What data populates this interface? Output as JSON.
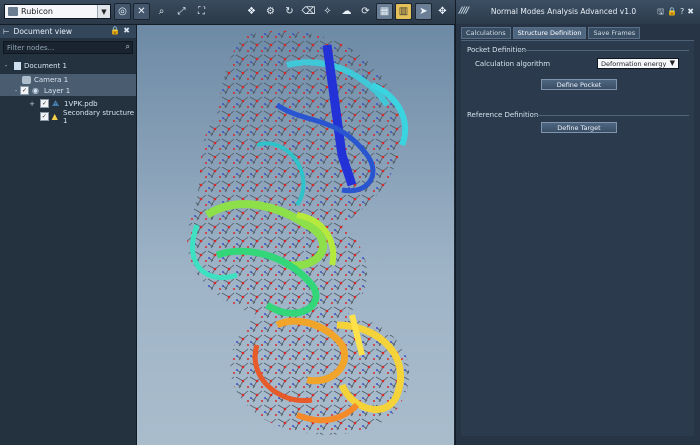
{
  "toolbar": {
    "preset": "Rubicon",
    "buttons": [
      "target-icon",
      "close-icon",
      "zoom-icon",
      "fit-icon",
      "fit-selection-icon",
      "atom-style-icon",
      "wire-icon",
      "rotate-icon",
      "eraser-icon",
      "ribbon-icon",
      "surface-icon",
      "refresh-icon",
      "grid-icon",
      "color-icon",
      "display-icon",
      "pointer-icon",
      "move-icon"
    ]
  },
  "document_view": {
    "title": "Document view",
    "filter_placeholder": "Filter nodes...",
    "tree": [
      {
        "label": "Document 1",
        "level": 0,
        "expander": "-",
        "checked": null,
        "icon": "document-icon",
        "selected": false
      },
      {
        "label": "Camera 1",
        "level": 1,
        "expander": "",
        "checked": null,
        "icon": "camera-icon",
        "selected": true
      },
      {
        "label": "Layer 1",
        "level": 1,
        "expander": "-",
        "checked": true,
        "icon": "eye-icon",
        "selected": true
      },
      {
        "label": "1VPK.pdb",
        "level": 2,
        "expander": "+",
        "checked": true,
        "icon": "molecule-icon",
        "selected": false
      },
      {
        "label": "Secondary structure 1",
        "level": 2,
        "expander": "",
        "checked": true,
        "icon": "ribbon-icon",
        "selected": false
      }
    ]
  },
  "plugin": {
    "title": "Normal Modes Analysis Advanced v1.0",
    "tabs": [
      {
        "label": "Calculations",
        "active": false
      },
      {
        "label": "Structure Definition",
        "active": true
      },
      {
        "label": "Save Frames",
        "active": false
      }
    ],
    "pocket_section": "Pocket Definition",
    "calc_algorithm_label": "Calculation algorithm",
    "calc_algorithm_value": "Deformation energy",
    "define_pocket": "Define Pocket",
    "reference_section": "Reference Definition",
    "define_target": "Define Target"
  },
  "colors": {
    "accent": "#4f6680",
    "viewport_top": "#6d8aa5",
    "viewport_bottom": "#a8bccc"
  }
}
